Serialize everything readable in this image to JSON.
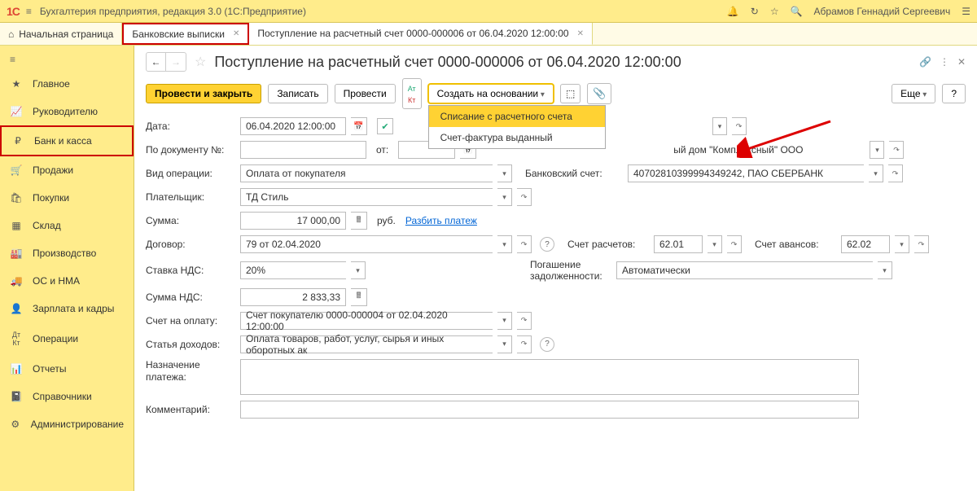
{
  "topbar": {
    "title": "Бухгалтерия предприятия, редакция 3.0  (1С:Предприятие)",
    "user": "Абрамов Геннадий Сергеевич"
  },
  "tabs": {
    "home": "Начальная страница",
    "bank": "Банковские выписки",
    "doc": "Поступление на расчетный счет 0000-000006 от 06.04.2020 12:00:00"
  },
  "sidebar": [
    "Главное",
    "Руководителю",
    "Банк и касса",
    "Продажи",
    "Покупки",
    "Склад",
    "Производство",
    "ОС и НМА",
    "Зарплата и кадры",
    "Операции",
    "Отчеты",
    "Справочники",
    "Администрирование"
  ],
  "doc": {
    "title": "Поступление на расчетный счет 0000-000006 от 06.04.2020 12:00:00",
    "toolbar": {
      "post_close": "Провести и закрыть",
      "write": "Записать",
      "post": "Провести",
      "create_on": "Создать на основании",
      "more": "Еще",
      "help": "?"
    },
    "menu": {
      "item1": "Списание с расчетного счета",
      "item2": "Счет-фактура выданный"
    },
    "labels": {
      "date": "Дата:",
      "docnum": "По документу №:",
      "from": "от:",
      "operation": "Вид операции:",
      "bank_account": "Банковский счет:",
      "payer": "Плательщик:",
      "sum": "Сумма:",
      "rub": "руб.",
      "split": "Разбить платеж",
      "contract": "Договор:",
      "acc_settle": "Счет расчетов:",
      "acc_advance": "Счет авансов:",
      "vat_rate": "Ставка НДС:",
      "vat_sum": "Сумма НДС:",
      "debt": "Погашение задолженности:",
      "invoice": "Счет на оплату:",
      "income": "Статья доходов:",
      "purpose": "Назначение платежа:",
      "comment": "Комментарий:",
      "org_suffix": "ый дом \"Комплексный\" ООО"
    },
    "values": {
      "date": "06.04.2020 12:00:00",
      "operation": "Оплата от покупателя",
      "bank_account": "40702810399994349242, ПАО СБЕРБАНК",
      "payer": "ТД Стиль",
      "sum": "17 000,00",
      "contract": "79 от 02.04.2020",
      "acc_settle": "62.01",
      "acc_advance": "62.02",
      "vat_rate": "20%",
      "vat_sum": "2 833,33",
      "debt": "Автоматически",
      "invoice": "Счет покупателю 0000-000004 от 02.04.2020 12:00:00",
      "income": "Оплата товаров, работ, услуг, сырья и иных оборотных ак"
    }
  }
}
